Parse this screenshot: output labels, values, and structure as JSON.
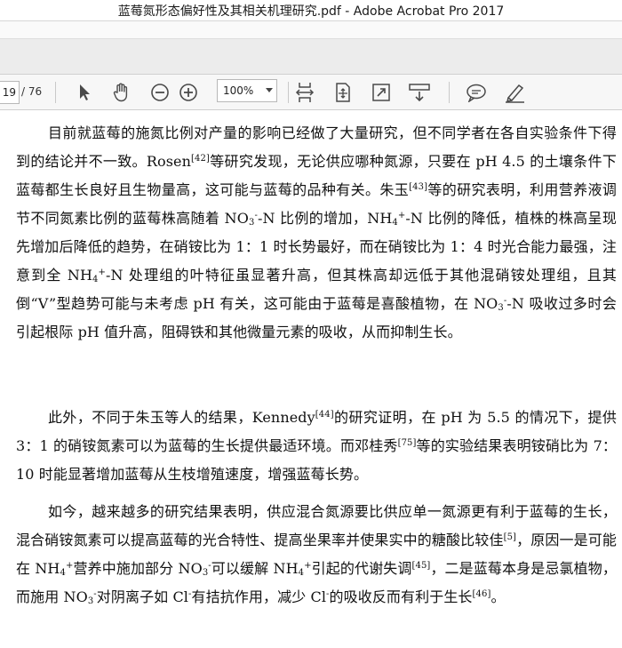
{
  "window": {
    "title": "蓝莓氮形态偏好性及其相关机理研究.pdf - Adobe Acrobat Pro 2017"
  },
  "toolbar": {
    "page_current": "19",
    "page_total": "/ 76",
    "zoom_level": "100%",
    "icon_color": "#4a4a4a"
  },
  "document": {
    "paragraphs": [
      {
        "text_a": "目前就蓝莓的施氮比例对产量的影响已经做了大量研究，但不同学者在各自实验条件下得到的结论并不一致。Rosen",
        "ref_a": "[42]",
        "text_b": "等研究发现，无论供应哪种氮源，只要在 pH 4.5 的土壤条件下蓝莓都生长良好且生物量高，这可能与蓝莓的品种有关。朱玉",
        "ref_b": "[43]",
        "text_c": "等的研究表明，利用营养液调节不同氮素比例的蓝莓株高随着 NO",
        "sub_1": "3",
        "sup_1": "-",
        "text_d": "-N 比例的增加，NH",
        "sub_2": "4",
        "sup_2": "+",
        "text_e": "-N 比例的降低，植株的株高呈现先增加后降低的趋势，在硝铵比为 1：1 时长势最好，而在硝铵比为 1：4 时光合能力最强，注意到全 NH",
        "sub_3": "4",
        "sup_3": "+",
        "text_f": "-N 处理组的叶特征虽显著升高，但其株高却远低于其他混硝铵处理组，且其倒“V”型趋势可能与未考虑 pH 有关，这可能由于蓝莓是喜酸植物，在 NO",
        "sub_4": "3",
        "sup_4": "-",
        "text_g": "-N 吸收过多时会引起根际 pH 值升高，阻碍铁和其他微量元素的吸收，从而抑制生长。"
      },
      {
        "text_a": "此外，不同于朱玉等人的结果，Kennedy",
        "ref_a": "[44]",
        "text_b": "的研究证明，在 pH 为 5.5 的情况下，提供 3：1 的硝铵氮素可以为蓝莓的生长提供最适环境。而邓桂秀",
        "ref_b": "[75]",
        "text_c": "等的实验结果表明铵硝比为 7：10 时能显著增加蓝莓从生枝增殖速度，增强蓝莓长势。"
      },
      {
        "text_a": "如今，越来越多的研究结果表明，供应混合氮源要比供应单一氮源更有利于蓝莓的生长，混合硝铵氮素可以提高蓝莓的光合特性、提高坐果率并使果实中的糖酸比较佳",
        "ref_a": "[5]",
        "text_b": "，原因一是可能在 NH",
        "sub_1": "4",
        "sup_1": "+",
        "text_c": "营养中施加部分 NO",
        "sub_2": "3",
        "sup_2": "-",
        "text_d": "可以缓解 NH",
        "sub_3": "4",
        "sup_3": "+",
        "text_e": "引起的代谢失调",
        "ref_b": "[45]",
        "text_f": "，二是蓝莓本身是忌氯植物，而施用 NO",
        "sub_4": "3",
        "sup_4": "-",
        "text_g": "对阴离子如 Cl",
        "sup_5": "-",
        "text_h": "有拮抗作用，减少 Cl",
        "sup_6": "-",
        "text_i": "的吸收反而有利于生长",
        "ref_c": "[46]",
        "text_j": "。"
      }
    ]
  }
}
